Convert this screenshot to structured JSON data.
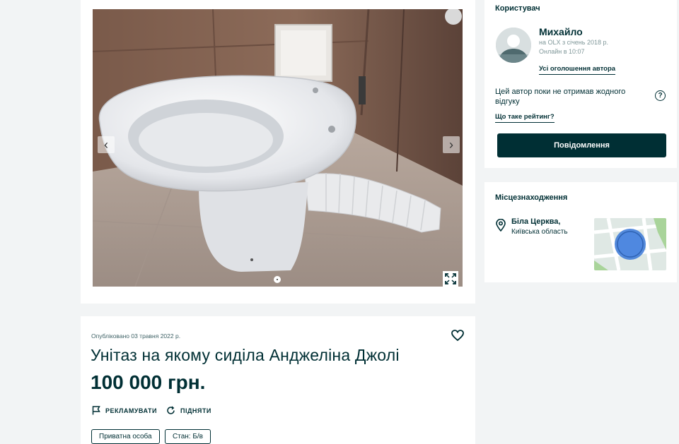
{
  "gallery": {
    "prev_arrow": "‹",
    "next_arrow": "›"
  },
  "listing": {
    "published": "Опубліковано 03 травня 2022 р.",
    "title": "Унітаз на якому сиділа Анджеліна Джолі",
    "price": "100 000 грн.",
    "promote_label": "РЕКЛАМУВАТИ",
    "raise_label": "ПІДНЯТИ",
    "tags": [
      "Приватна особа",
      "Стан: Б/в"
    ]
  },
  "user": {
    "heading": "Користувач",
    "name": "Михайло",
    "since": "на OLX з січень 2018 р.",
    "online": "Онлайн в 10:07",
    "all_ads_link": "Усі оголошення автора",
    "rating_text": "Цей автор поки не отримав жодного відгуку",
    "help_symbol": "?",
    "rating_link": "Що таке рейтинг?",
    "message_button": "Повідомлення"
  },
  "location": {
    "heading": "Місцезнаходження",
    "city": "Біла Церква,",
    "region": "Київська область"
  },
  "colors": {
    "brand_dark": "#002f34",
    "page_bg": "#f2f4f5",
    "map_marker": "#3a78d8"
  }
}
